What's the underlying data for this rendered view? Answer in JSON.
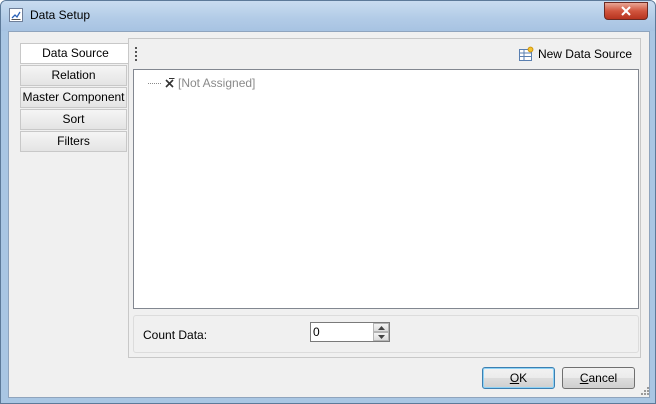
{
  "window": {
    "title": "Data Setup"
  },
  "tabs": [
    {
      "label": "Data Source",
      "active": true
    },
    {
      "label": "Relation"
    },
    {
      "label": "Master Component"
    },
    {
      "label": "Sort"
    },
    {
      "label": "Filters"
    }
  ],
  "toolbar": {
    "new_data_source_label": "New Data Source"
  },
  "tree": {
    "items": [
      {
        "label": "[Not Assigned]",
        "icon": "delete-x-icon"
      }
    ]
  },
  "count": {
    "label": "Count Data:",
    "value": "0"
  },
  "buttons": {
    "ok_mnemonic": "O",
    "ok_rest": "K",
    "cancel_mnemonic": "C",
    "cancel_rest": "ancel"
  }
}
